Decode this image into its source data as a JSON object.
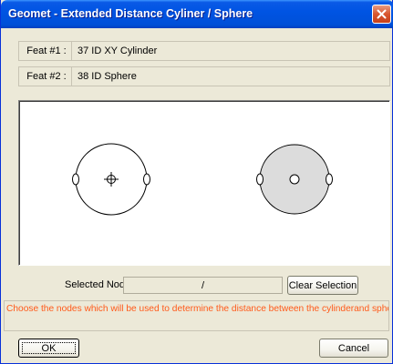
{
  "window": {
    "title": "Geomet - Extended Distance Cyliner / Sphere",
    "close_icon": "close-icon"
  },
  "features": [
    {
      "label": "Feat #1 :",
      "value": "37 ID XY Cylinder"
    },
    {
      "label": "Feat #2 :",
      "value": "38 ID Sphere"
    }
  ],
  "canvas": {
    "cylinder_icon": "cylinder-diagram-icon",
    "sphere_icon": "sphere-diagram-icon",
    "sphere_fill": "#dcdcdc"
  },
  "selection": {
    "label": "Selected Nodes :",
    "value": "/",
    "clear_button": "Clear Selection"
  },
  "message": {
    "text": "Choose the nodes which will be used to determine the distance between the cylinderand sphere.",
    "color": "#ff5a1a"
  },
  "buttons": {
    "ok": "OK",
    "cancel": "Cancel"
  },
  "colors": {
    "titlebar": "#0054e3",
    "dialog_bg": "#ece9d8",
    "close_button": "#d9562e"
  }
}
